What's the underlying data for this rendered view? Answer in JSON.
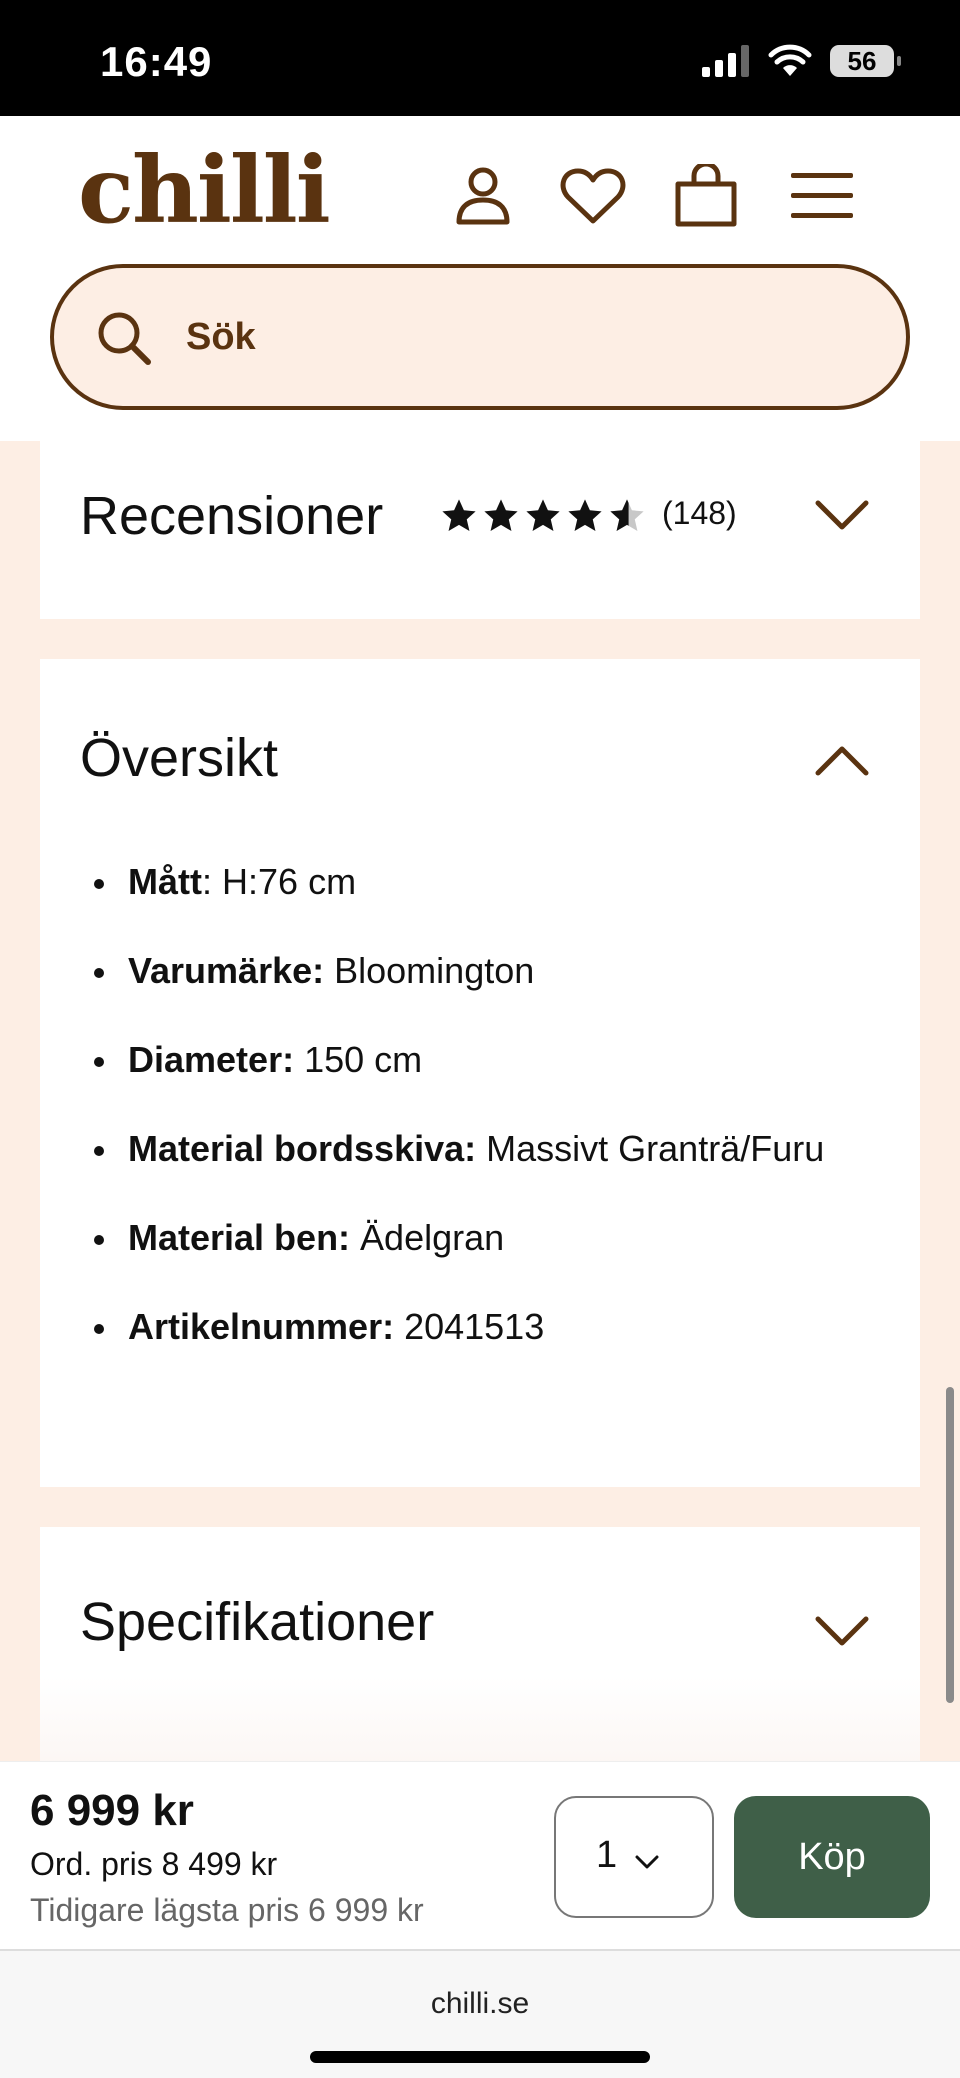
{
  "status_bar": {
    "time": "16:49",
    "battery": "56"
  },
  "header": {
    "logo": "chilli",
    "search_placeholder": "Sök"
  },
  "reviews": {
    "title": "Recensioner",
    "rating": 4.5,
    "count": "(148)"
  },
  "overview": {
    "title": "Översikt",
    "items": [
      {
        "label": "Mått",
        "value": " H:76 cm"
      },
      {
        "label": "Varumärke:",
        "value": " Bloomington"
      },
      {
        "label": "Diameter:",
        "value": " 150 cm"
      },
      {
        "label": "Material bordsskiva:",
        "value": " Massivt Granträ/Furu"
      },
      {
        "label": "Material ben:",
        "value": " Ädelgran"
      },
      {
        "label": "Artikelnummer:",
        "value": " 2041513"
      }
    ]
  },
  "specifications": {
    "title": "Specifikationer"
  },
  "purchase": {
    "price": "6 999 kr",
    "ordinary_price": "Ord. pris 8 499 kr",
    "lowest_price": "Tidigare lägsta pris 6 999 kr",
    "quantity": "1",
    "buy_label": "Köp"
  },
  "browser": {
    "url": "chilli.se"
  },
  "colors": {
    "brand_brown": "#5a3310",
    "cream": "#fdeee4",
    "buy_green": "#3f5f48"
  }
}
